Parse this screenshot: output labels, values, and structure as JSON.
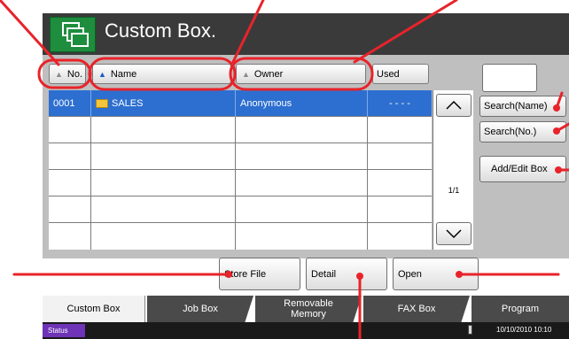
{
  "header": {
    "title": "Custom Box.",
    "icon": "copy-boxes-icon"
  },
  "columns": {
    "no": "No.",
    "name": "Name",
    "owner": "Owner",
    "used": "Used"
  },
  "table": {
    "rows": [
      {
        "no": "0001",
        "name": "SALES",
        "owner": "Anonymous",
        "used": "- - - -",
        "selected": true
      },
      {
        "no": "",
        "name": "",
        "owner": "",
        "used": ""
      },
      {
        "no": "",
        "name": "",
        "owner": "",
        "used": ""
      },
      {
        "no": "",
        "name": "",
        "owner": "",
        "used": ""
      },
      {
        "no": "",
        "name": "",
        "owner": "",
        "used": ""
      },
      {
        "no": "",
        "name": "",
        "owner": "",
        "used": ""
      }
    ]
  },
  "pagination": {
    "label": "1/1"
  },
  "side": {
    "search_name": "Search(Name)",
    "search_no": "Search(No.)",
    "add_edit": "Add/Edit Box"
  },
  "actions": {
    "store_file": "Store File",
    "detail": "Detail",
    "open": "Open"
  },
  "tabs": [
    {
      "label": "Custom Box",
      "active": true
    },
    {
      "label": "Job Box"
    },
    {
      "label": "Removable\nMemory"
    },
    {
      "label": "FAX Box"
    },
    {
      "label": "Program"
    }
  ],
  "status": {
    "button": "Status",
    "datetime": "10/10/2010 10:10"
  },
  "colors": {
    "selection": "#2d6fd0",
    "header_icon": "#1e8d3e",
    "callout": "#e8232a",
    "status_button": "#6e33b6"
  }
}
